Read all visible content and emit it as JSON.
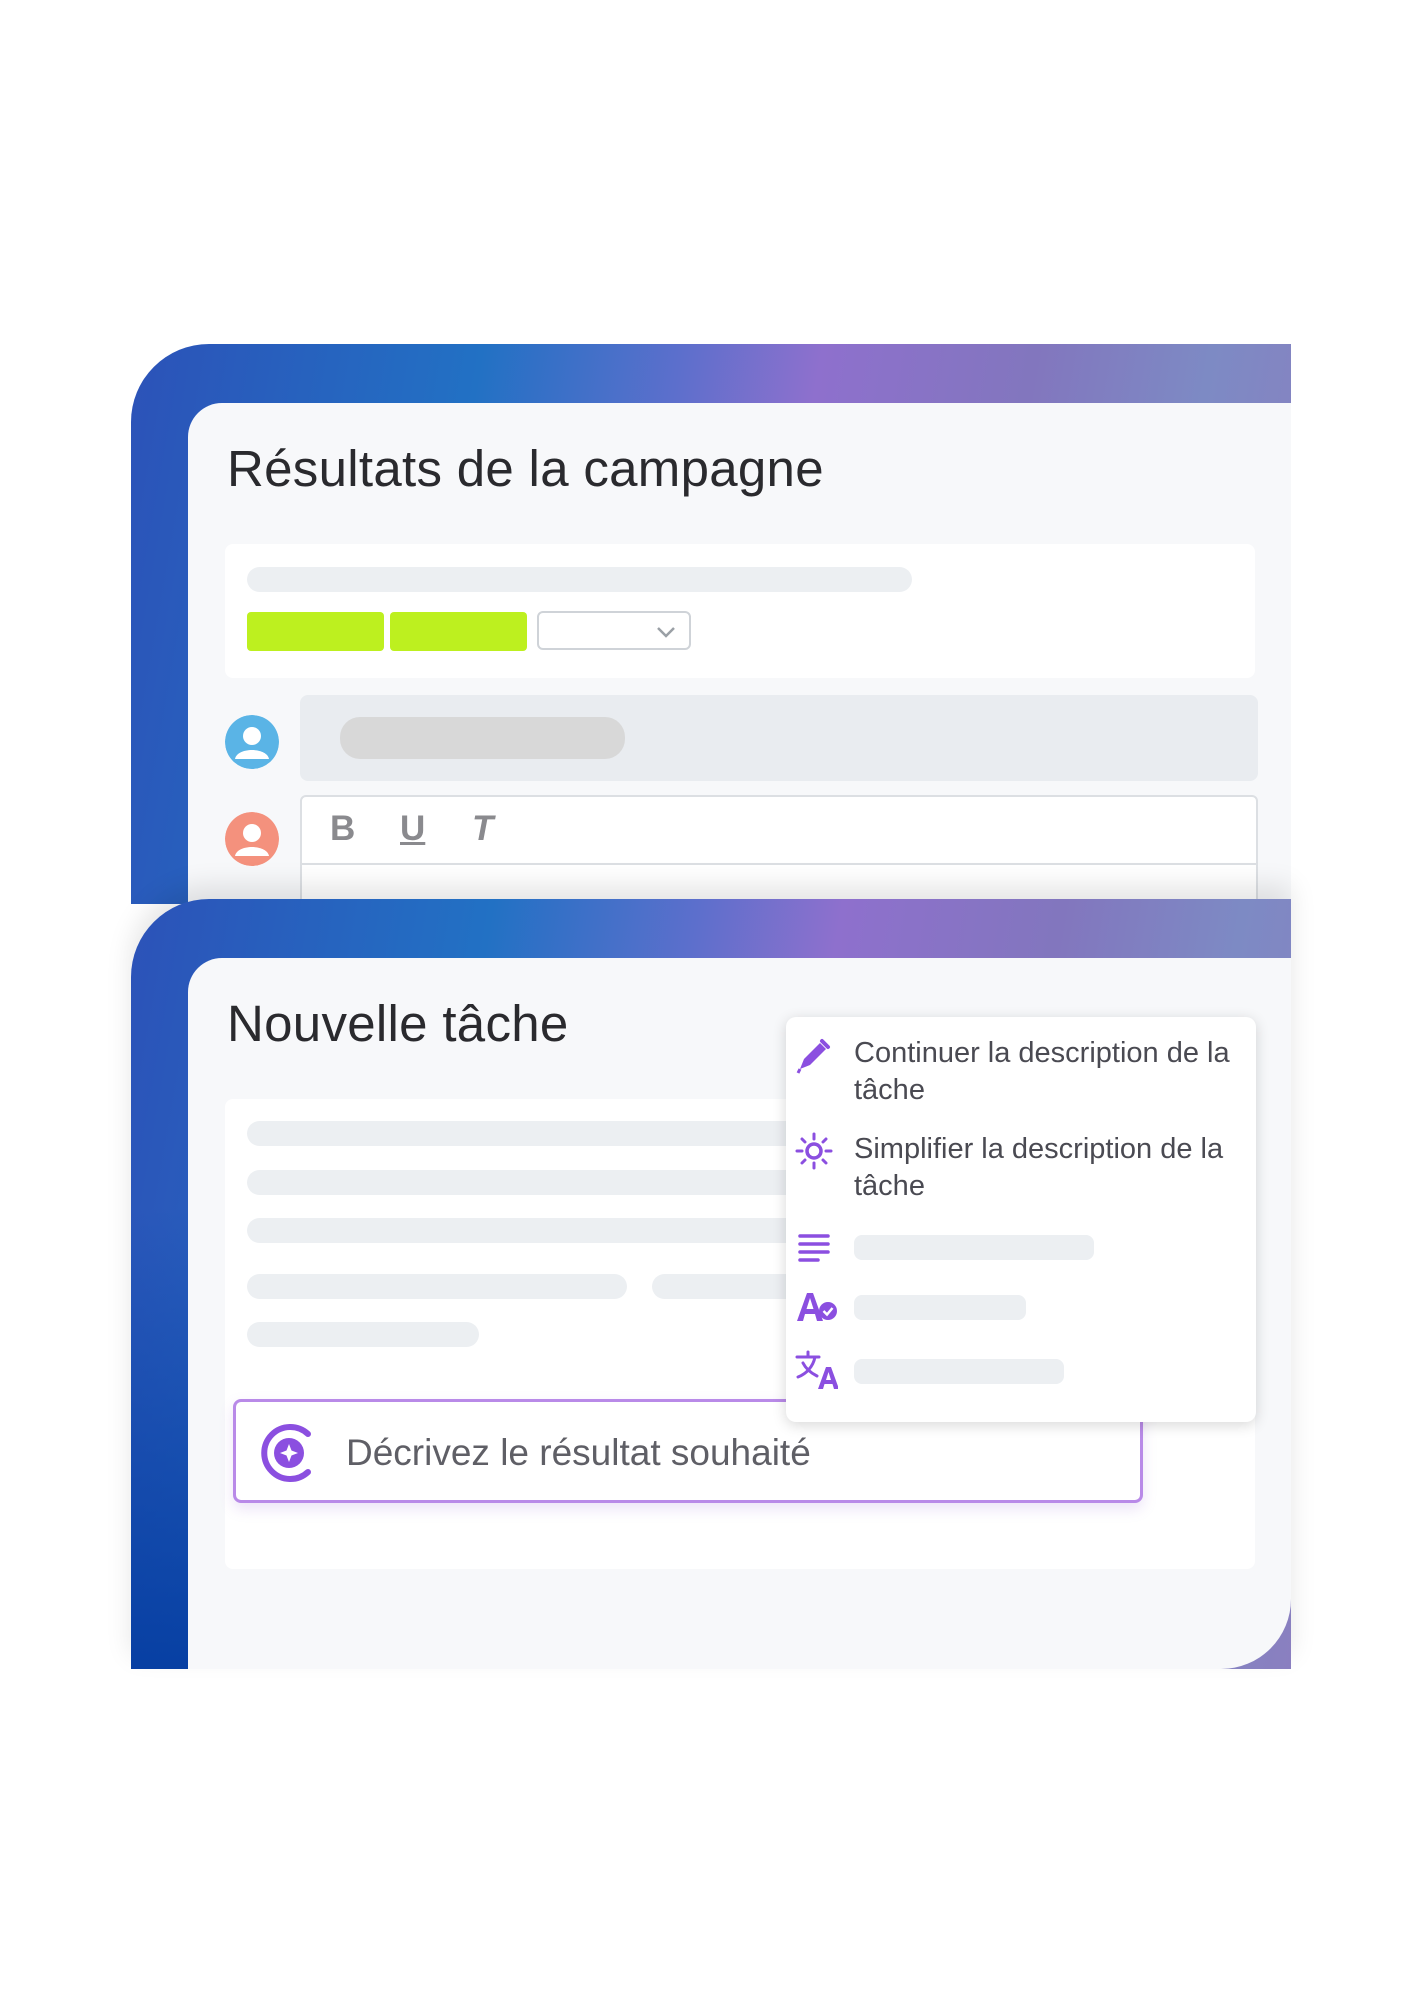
{
  "campaign": {
    "title": "Résultats de la campagne",
    "toolbar": {
      "bold": "B",
      "underline": "U",
      "italic": "T"
    },
    "colors": {
      "tag": "#bdf01f",
      "avatar_user1": "#5ab4e6",
      "avatar_user2": "#f4917d"
    }
  },
  "task": {
    "title": "Nouvelle tâche",
    "prompt_placeholder": "Décrivez le résultat souhaité",
    "menu": {
      "items": [
        {
          "icon": "pen-icon",
          "label": "Continuer la description de la tâche"
        },
        {
          "icon": "sun-icon",
          "label": "Simplifier la description de la tâche"
        },
        {
          "icon": "lines-icon",
          "label": ""
        },
        {
          "icon": "spellcheck-icon",
          "label": ""
        },
        {
          "icon": "translate-icon",
          "label": ""
        }
      ]
    },
    "colors": {
      "accent": "#8b4fe0",
      "prompt_border": "#b98ae8"
    }
  }
}
